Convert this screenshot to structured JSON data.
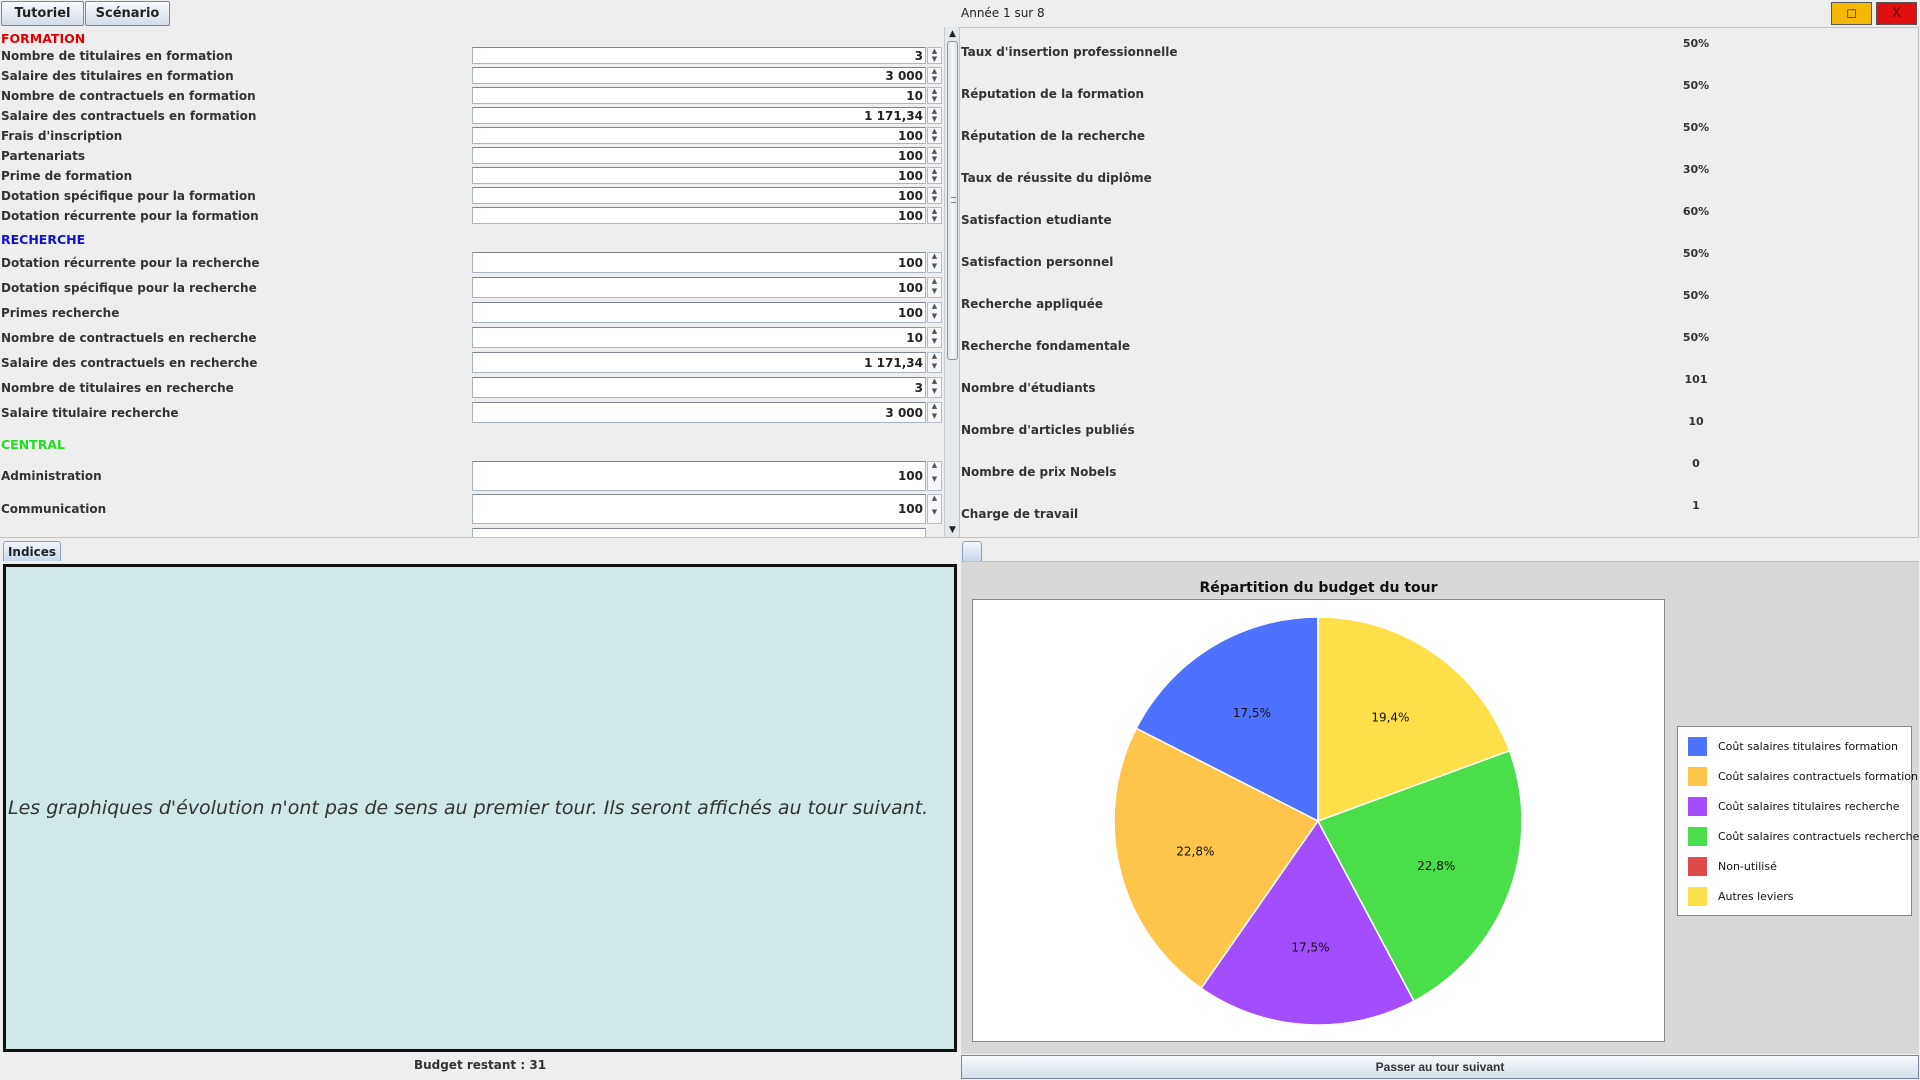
{
  "toolbar": {
    "tutoriel_label": "Tutoriel",
    "scenario_label": "Scénario"
  },
  "year_label": "Année 1 sur 8",
  "window": {
    "maximize_glyph": "◻",
    "close_glyph": "X",
    "maximize_color": "#f5b800",
    "close_color": "#e01010"
  },
  "parameters": {
    "formation": {
      "header": "FORMATION",
      "color": "#e00000",
      "rows": [
        {
          "label": "Nombre de titulaires en formation",
          "value": "3"
        },
        {
          "label": "Salaire des titulaires en formation",
          "value": "3 000"
        },
        {
          "label": "Nombre de contractuels en formation",
          "value": "10"
        },
        {
          "label": "Salaire des contractuels en formation",
          "value": "1 171,34"
        },
        {
          "label": "Frais d'inscription",
          "value": "100"
        },
        {
          "label": "Partenariats",
          "value": "100"
        },
        {
          "label": "Prime de formation",
          "value": "100"
        },
        {
          "label": "Dotation spécifique pour la formation",
          "value": "100"
        },
        {
          "label": "Dotation récurrente pour la formation",
          "value": "100"
        }
      ]
    },
    "recherche": {
      "header": "RECHERCHE",
      "color": "#1010d0",
      "rows": [
        {
          "label": "Dotation récurrente pour la recherche",
          "value": "100"
        },
        {
          "label": "Dotation spécifique pour la recherche",
          "value": "100"
        },
        {
          "label": "Primes recherche",
          "value": "100"
        },
        {
          "label": "Nombre de contractuels en recherche",
          "value": "10"
        },
        {
          "label": "Salaire des contractuels en recherche",
          "value": "1 171,34"
        },
        {
          "label": "Nombre de titulaires en recherche",
          "value": "3"
        },
        {
          "label": "Salaire titulaire recherche",
          "value": "3 000"
        }
      ]
    },
    "central": {
      "header": "CENTRAL",
      "color": "#22dd22",
      "rows": [
        {
          "label": "Administration",
          "value": "100"
        },
        {
          "label": "Communication",
          "value": "100"
        }
      ]
    }
  },
  "indicators": [
    {
      "label": "Taux d'insertion professionnelle",
      "value": "50%"
    },
    {
      "label": "Réputation de la formation",
      "value": "50%"
    },
    {
      "label": "Réputation de la recherche",
      "value": "50%"
    },
    {
      "label": "Taux de réussite du diplôme",
      "value": "30%"
    },
    {
      "label": "Satisfaction etudiante",
      "value": "60%"
    },
    {
      "label": "Satisfaction personnel",
      "value": "50%"
    },
    {
      "label": "Recherche appliquée",
      "value": "50%"
    },
    {
      "label": "Recherche fondamentale",
      "value": "50%"
    },
    {
      "label": "Nombre d'étudiants",
      "value": "101"
    },
    {
      "label": "Nombre d'articles publiés",
      "value": "10"
    },
    {
      "label": "Nombre de prix Nobels",
      "value": "0"
    },
    {
      "label": "Charge de travail",
      "value": "1"
    }
  ],
  "tabs": {
    "indices_label": "Indices"
  },
  "hint_text": "Les graphiques d'évolution n'ont pas de sens au premier tour. Ils seront affichés au tour suivant.",
  "budget": {
    "label": "Budget restant :",
    "value": "31"
  },
  "next_button_label": "Passer au tour suivant",
  "chart_data": {
    "type": "pie",
    "title": "Répartition du budget du tour",
    "legend_position": "right",
    "slices": [
      {
        "name": "Coût salaires titulaires formation",
        "value": 17.5,
        "label": "17,5%",
        "color": "#4d72ff"
      },
      {
        "name": "Coût salaires contractuels formation",
        "value": 22.8,
        "label": "22,8%",
        "color": "#ffc44a"
      },
      {
        "name": "Coût salaires titulaires recherche",
        "value": 17.5,
        "label": "17,5%",
        "color": "#a44dff"
      },
      {
        "name": "Coût salaires contractuels recherche",
        "value": 22.8,
        "label": "22,8%",
        "color": "#4ade4a"
      },
      {
        "name": "Non-utilisé",
        "value": 0,
        "label": "",
        "color": "#e04a4a"
      },
      {
        "name": "Autres leviers",
        "value": 19.4,
        "label": "19,4%",
        "color": "#ffe04a"
      }
    ]
  }
}
